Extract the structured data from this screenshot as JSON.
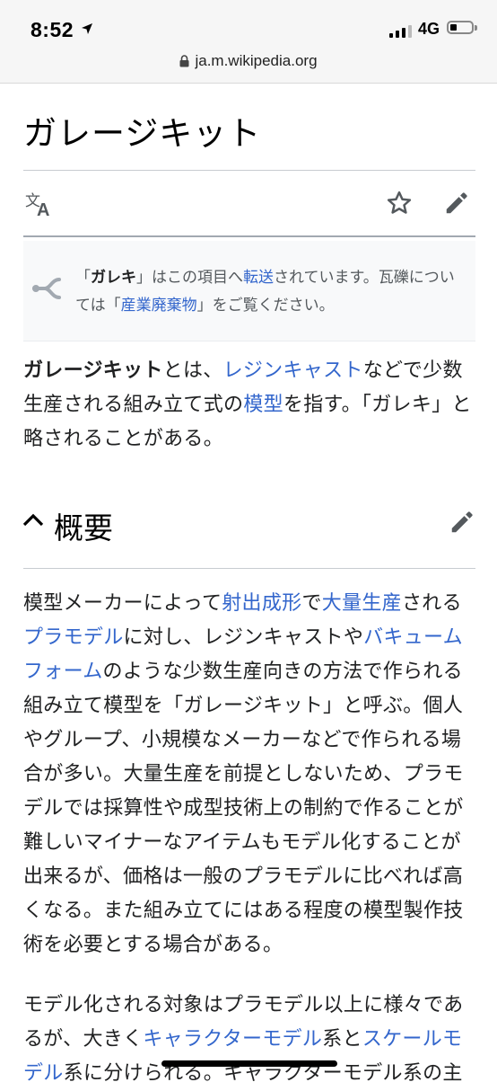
{
  "status_bar": {
    "time": "8:52",
    "network": "4G",
    "url": "ja.m.wikipedia.org"
  },
  "article": {
    "title": "ガレージキット",
    "actions": {
      "language_icon": "translate-icon",
      "watch_icon": "star-icon",
      "edit_icon": "pencil-icon"
    }
  },
  "hatnote": {
    "icon": "redirect-arrow-icon",
    "p1": "「",
    "bold": "ガレキ",
    "p2": "」はこの項目へ",
    "link1": "転送",
    "p3": "されています。瓦礫については「",
    "link2": "産業廃棄物",
    "p4": "」をご覧ください。"
  },
  "lead": {
    "bold": "ガレージキット",
    "t1": "とは、",
    "link1": "レジンキャスト",
    "t2": "などで少数生産される組み立て式の",
    "link2": "模型",
    "t3": "を指す。「ガレキ」と略されることがある。"
  },
  "section": {
    "title": "概要",
    "collapse_icon": "chevron-up-icon",
    "edit_icon": "pencil-icon"
  },
  "body1": {
    "t1": "模型メーカーによって",
    "link1": "射出成形",
    "t2": "で",
    "link2": "大量生産",
    "t3": "される",
    "link3": "プラモデル",
    "t4": "に対し、レジンキャストや",
    "link4": "バキュームフォーム",
    "t5": "のような少数生産向きの方法で作られる組み立て模型を「ガレージキット」と呼ぶ。個人やグループ、小規模なメーカーなどで作られる場合が多い。大量生産を前提としないため、プラモデルでは採算性や成型技術上の制約で作ることが難しいマイナーなアイテムもモデル化することが出来るが、価格は一般のプラモデルに比べれば高くなる。また組み立てにはある程度の模型製作技術を必要とする場合がある。"
  },
  "body2": {
    "t1": "モデル化される対象はプラモデル以上に様々であるが、大きく",
    "link1": "キャラクターモデル",
    "t2": "系と",
    "link2": "スケールモデル",
    "t3": "系に分けられる。キャラクターモデル系の主"
  },
  "colors": {
    "link": "#3366cc",
    "text": "#202122",
    "hatnote_bg": "#f8f9fa"
  }
}
